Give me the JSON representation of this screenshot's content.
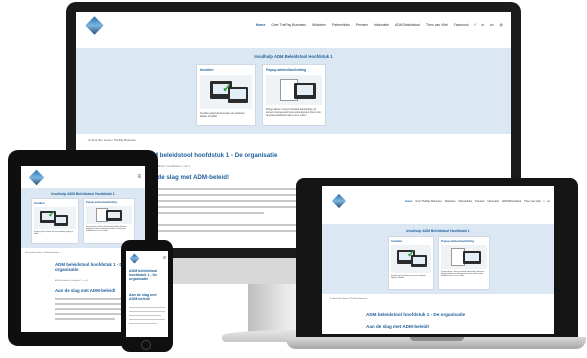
{
  "site": {
    "nav": [
      "Home",
      "Over ThePay Business",
      "Winkelen",
      "Partnerlinks",
      "Preview",
      "Informatie",
      "ADM Beleidstool",
      "Theo van Vilet",
      "Facebook",
      "Twitter",
      "Instagram",
      "Email"
    ],
    "nav_short": [
      "f",
      "in",
      "tw",
      "@"
    ],
    "hero_title": "Invulhulp ADM Beleidstool Hoofdstuk 1",
    "card1_title": "Invullen",
    "card1_text": "Invullen gaat het best aan een desktop, laptop of tablet",
    "card2_title": "Popup advies/toelichting",
    "card2_text": "Popup advies / tekst in bestand aanhouding, af­kunnen doorgevoerd bouw adviespunten hierin voor de juiste beleidstool aan t uw te vullen",
    "breadcrumb": "Je bent hier: Home / ThePay Business",
    "page_title": "ADM beleidstool hoofdstuk 1 - De organisatie",
    "meta": "ADM Beleidstool • hoofdstuk 1 • vol 1",
    "section_title": "Aan de slag met ADM-beleid!",
    "phone_title": "ADM beleidstool hoofdstuk 1 - De organisatie",
    "phone_section": "Aan de slag met ADM-beleid!"
  },
  "colors": {
    "brand": "#1f5f99",
    "hero_bg": "#dbe8f3",
    "device_frame": "#111111"
  },
  "icons": {
    "logo": "diamond-logo-icon",
    "monitor_graphic": "monitor-checkmarks-icon",
    "document_graphic": "document-icon"
  }
}
